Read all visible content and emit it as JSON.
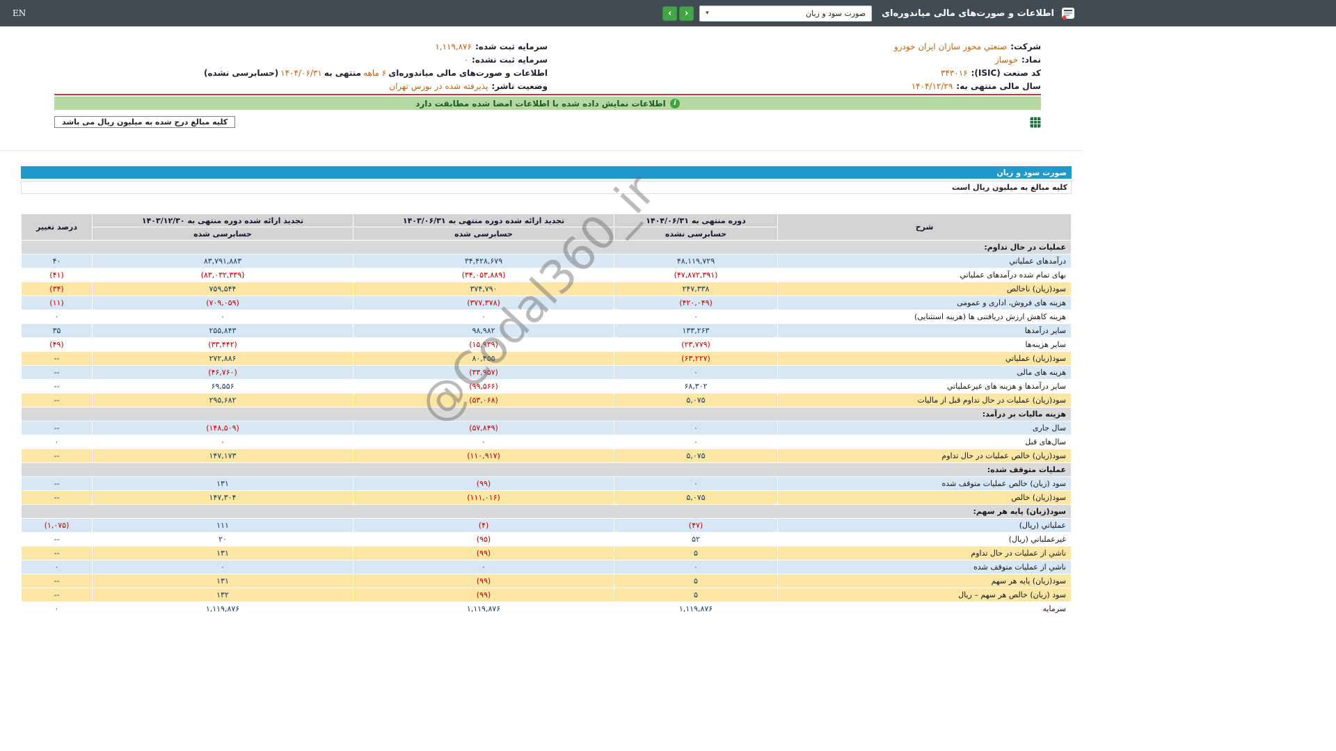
{
  "colors": {
    "topbar_bg": "#3f4b55",
    "accent_orange": "#c2620e",
    "negative_red": "#c00000",
    "value_navy": "#17365d",
    "title_bar_blue": "#2398ca",
    "banner_green_bg": "#b5d8a0",
    "row_blue": "#d8e7f4",
    "row_yellow": "#fce6a4",
    "section_gray": "#d9d9d9",
    "nav_button_green": "#45a348",
    "red_divider": "#c03a3a"
  },
  "topbar": {
    "en_label": "EN",
    "title": "اطلاعات و صورت‌های مالی میاندوره‌ای",
    "dropdown_value": "صورت سود و زیان",
    "prev_icon": "‹",
    "next_icon": "›",
    "caret": "▾"
  },
  "company": {
    "right": [
      {
        "label": "شرکت:",
        "value": "صنعتي محور سازان ايران خودرو"
      },
      {
        "label": "نماد:",
        "value": "خوساز"
      },
      {
        "label": "کد صنعت (ISIC):",
        "value": "۳۴۳۰۱۶"
      },
      {
        "label": "سال مالی منتهی به:",
        "value": "۱۴۰۴/۱۲/۲۹"
      }
    ],
    "left": [
      {
        "label": "سرمایه ثبت شده:",
        "value": "۱,۱۱۹,۸۷۶"
      },
      {
        "label": "سرمایه ثبت نشده:",
        "value": "۰"
      },
      {
        "label": "اطلاعات و صورت‌های مالی میاندوره‌ای",
        "period": "۶ ماهه",
        "mid": "منتهی به",
        "date": "۱۴۰۴/۰۶/۳۱",
        "suffix": "(حسابرسی نشده)"
      },
      {
        "label": "وضعیت ناشر:",
        "value": "پذیرفته شده در بورس تهران"
      }
    ]
  },
  "banner": {
    "icon": "i",
    "text": "اطلاعات نمایش داده شده با اطلاعات امضا شده مطابقت دارد"
  },
  "notes": {
    "unit_box": "کلیه مبالغ درج شده به میلیون ریال می باشد"
  },
  "statement": {
    "title": "صورت سود و زیان",
    "unit_note": "کلیه مبالغ به میلیون ریال است",
    "watermark": "@Codal360_ir",
    "table": {
      "headers": {
        "desc": "شرح",
        "current_title": "دوره منتهی به ۱۴۰۴/۰۶/۳۱",
        "current_sub": "حسابرسی نشده",
        "restated_mid_title": "تجدید ارائه شده دوره منتهی به ۱۴۰۳/۰۶/۳۱",
        "restated_mid_sub": "حسابرسی شده",
        "restated_year_title": "تجدید ارائه شده دوره منتهی به ۱۴۰۳/۱۲/۳۰",
        "restated_year_sub": "حسابرسی شده",
        "change": "درصد تغییر"
      },
      "rows": [
        {
          "type": "section",
          "label": "عملیات در حال تداوم:"
        },
        {
          "type": "data",
          "style": "blue",
          "label": "درآمدهای عملیاتي",
          "values": [
            "۴۸,۱۱۹,۷۲۹",
            "۳۴,۴۲۸,۶۷۹",
            "۸۳,۷۹۱,۸۸۳"
          ],
          "change": "۴۰"
        },
        {
          "type": "data",
          "style": "white",
          "label": "بهای تمام شده درآمدهای عملیاتي",
          "values": [
            "(۴۷,۸۷۲,۳۹۱)",
            "(۳۴,۰۵۳,۸۸۹)",
            "(۸۳,۰۳۲,۳۳۹)"
          ],
          "change": "(۴۱)"
        },
        {
          "type": "data",
          "style": "yellow",
          "label": "سود(زیان) ناخالص",
          "values": [
            "۲۴۷,۳۳۸",
            "۳۷۴,۷۹۰",
            "۷۵۹,۵۴۴"
          ],
          "change": "(۳۴)"
        },
        {
          "type": "data",
          "style": "blue",
          "label": "هزینه های فروش، اداری و عمومی",
          "values": [
            "(۴۲۰,۰۴۹)",
            "(۳۷۷,۳۷۸)",
            "(۷۰۹,۰۵۹)"
          ],
          "change": "(۱۱)"
        },
        {
          "type": "data",
          "style": "white",
          "label": "هزینه کاهش ارزش دریافتنی ها (هزینه استثنایی)",
          "values": [
            "۰",
            "۰",
            "۰"
          ],
          "change": "۰"
        },
        {
          "type": "data",
          "style": "blue",
          "label": "سایر درآمدها",
          "values": [
            "۱۳۳,۲۶۳",
            "۹۸,۹۸۲",
            "۲۵۵,۸۴۳"
          ],
          "change": "۳۵"
        },
        {
          "type": "data",
          "style": "white",
          "label": "سایر هزینه‌ها",
          "values": [
            "(۲۳,۷۷۹)",
            "(۱۵,۹۳۹)",
            "(۳۳,۴۴۲)"
          ],
          "change": "(۴۹)"
        },
        {
          "type": "data",
          "style": "yellow",
          "label": "سود(زیان) عملیاتي",
          "values": [
            "(۶۳,۲۲۷)",
            "۸۰,۴۵۵",
            "۲۷۲,۸۸۶"
          ],
          "change": "--"
        },
        {
          "type": "data",
          "style": "blue",
          "label": "هزینه های مالی",
          "values": [
            "۰",
            "(۳۳,۹۵۷)",
            "(۴۶,۷۶۰)"
          ],
          "change": "--"
        },
        {
          "type": "data",
          "style": "white",
          "label": "سایر درآمدها و هزینه های غیرعملیاتي",
          "values": [
            "۶۸,۳۰۲",
            "(۹۹,۵۶۶)",
            "۶۹,۵۵۶"
          ],
          "change": "--"
        },
        {
          "type": "data",
          "style": "yellow",
          "label": "سود(زیان) عملیات در حال تداوم قبل از مالیات",
          "values": [
            "۵,۰۷۵",
            "(۵۳,۰۶۸)",
            "۲۹۵,۶۸۲"
          ],
          "change": "--"
        },
        {
          "type": "section",
          "label": "هزینه مالیات بر درآمد:"
        },
        {
          "type": "data",
          "style": "blue",
          "label": "سال جاری",
          "values": [
            "۰",
            "(۵۷,۸۴۹)",
            "(۱۴۸,۵۰۹)"
          ],
          "change": "--"
        },
        {
          "type": "data",
          "style": "white",
          "label": "سال‌های قبل",
          "values": [
            "۰",
            "۰",
            "۰"
          ],
          "change": "۰"
        },
        {
          "type": "data",
          "style": "yellow",
          "label": "سود(زیان) خالص عملیات در حال تداوم",
          "values": [
            "۵,۰۷۵",
            "(۱۱۰,۹۱۷)",
            "۱۴۷,۱۷۳"
          ],
          "change": "--"
        },
        {
          "type": "section",
          "label": "عملیات متوقف شده:"
        },
        {
          "type": "data",
          "style": "blue",
          "label": "سود (زیان) خالص عملیات متوقف شده",
          "values": [
            "۰",
            "(۹۹)",
            "۱۳۱"
          ],
          "change": "--"
        },
        {
          "type": "data",
          "style": "yellow",
          "label": "سود(زیان) خالص",
          "values": [
            "۵,۰۷۵",
            "(۱۱۱,۰۱۶)",
            "۱۴۷,۳۰۴"
          ],
          "change": "--"
        },
        {
          "type": "section",
          "label": "سود(زیان) پایه هر سهم:"
        },
        {
          "type": "data",
          "style": "blue",
          "label": "عملیاتي (ریال)",
          "values": [
            "(۴۷)",
            "(۴)",
            "۱۱۱"
          ],
          "change": "(۱,۰۷۵)"
        },
        {
          "type": "data",
          "style": "white",
          "label": "غیرعملیاتي (ریال)",
          "values": [
            "۵۲",
            "(۹۵)",
            "۲۰"
          ],
          "change": "--"
        },
        {
          "type": "data",
          "style": "yellow",
          "label": "ناشي از عملیات در حال تداوم",
          "values": [
            "۵",
            "(۹۹)",
            "۱۳۱"
          ],
          "change": "--"
        },
        {
          "type": "data",
          "style": "blue",
          "label": "ناشي از عملیات متوقف شده",
          "values": [
            "۰",
            "۰",
            "۰"
          ],
          "change": "۰"
        },
        {
          "type": "data",
          "style": "yellow",
          "label": "سود(زیان) پایه هر سهم",
          "values": [
            "۵",
            "(۹۹)",
            "۱۳۱"
          ],
          "change": "--"
        },
        {
          "type": "data",
          "style": "yellow",
          "label": "سود (زیان) خالص هر سهم – ریال",
          "values": [
            "۵",
            "(۹۹)",
            "۱۳۲"
          ],
          "change": "--"
        },
        {
          "type": "data",
          "style": "white",
          "label": "سرمایه",
          "values": [
            "۱,۱۱۹,۸۷۶",
            "۱,۱۱۹,۸۷۶",
            "۱,۱۱۹,۸۷۶"
          ],
          "change": "۰"
        }
      ]
    }
  }
}
